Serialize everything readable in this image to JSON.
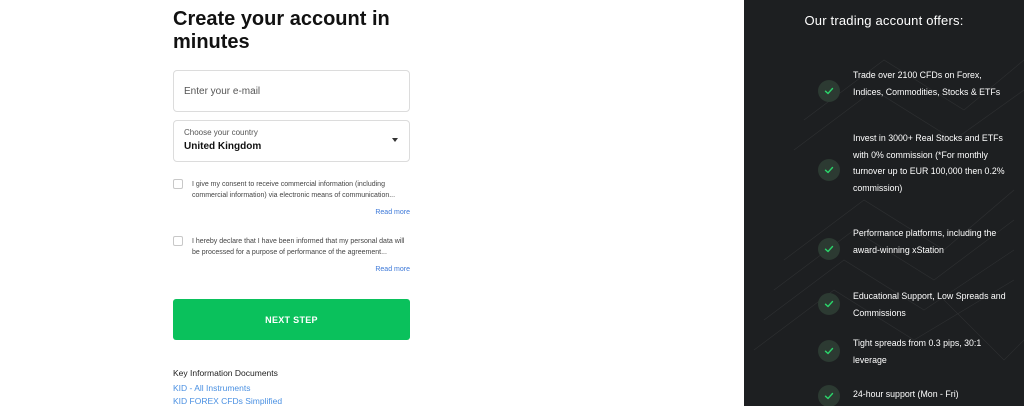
{
  "form": {
    "title": "Create your account in minutes",
    "email_placeholder": "Enter your e-mail",
    "country_label": "Choose your country",
    "country_value": "United Kingdom",
    "consents": [
      {
        "text": "I give my consent to receive commercial information (including commercial information) via electronic means of communication...",
        "read_more": "Read more",
        "checked": false
      },
      {
        "text": "I hereby declare that I have been informed that my personal data will be processed for a purpose of performance of the agreement...",
        "read_more": "Read more",
        "checked": false
      }
    ],
    "next_button": "NEXT STEP"
  },
  "kid": {
    "title": "Key Information Documents",
    "links": [
      "KID - All Instruments",
      "KID FOREX CFDs Simplified"
    ]
  },
  "offers": {
    "title": "Our trading account offers:",
    "items": [
      "Trade over 2100 CFDs on Forex, Indices, Commodities, Stocks & ETFs",
      "Invest in 3000+ Real Stocks and ETFs with 0% commission (*For monthly turnover up to EUR 100,000 then 0.2% commission)",
      "Performance platforms, including the award-winning xStation",
      "Educational Support, Low Spreads and Commissions",
      "Tight spreads from 0.3 pips, 30:1 leverage",
      "24-hour support (Mon - Fri)"
    ],
    "check_icon": "check-icon"
  },
  "colors": {
    "accent_green": "#0ac15c",
    "panel_dark": "#1d1f21",
    "link_blue": "#4a90e2",
    "check_green": "#2bd46a"
  }
}
